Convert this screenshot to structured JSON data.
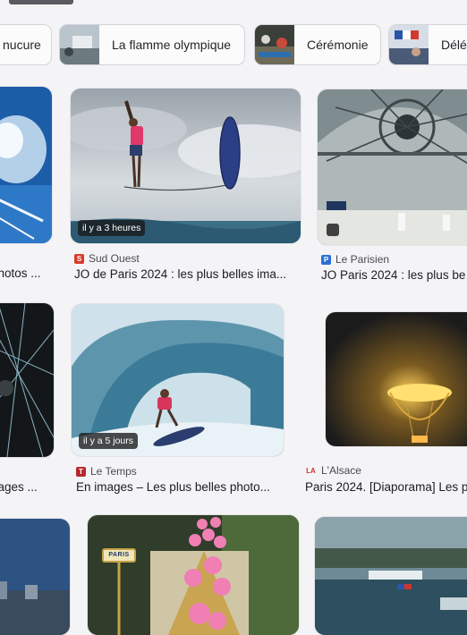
{
  "chips": [
    {
      "label": "nucure"
    },
    {
      "label": "La flamme olympique"
    },
    {
      "label": "Cérémonie"
    },
    {
      "label": "Délég"
    }
  ],
  "cards": {
    "surf1": {
      "time": "il y a 3 heures",
      "source": "Sud Ouest",
      "title": "JO de Paris 2024 : les plus belles ima..."
    },
    "dome": {
      "source": "Le Parisien",
      "title": "JO Paris 2024 : les plus be"
    },
    "left_top": {
      "title": "photos ..."
    },
    "surf2": {
      "time": "il y a 5 jours",
      "source": "Le Temps",
      "title": "En images – Les plus belles photo..."
    },
    "balloon": {
      "source": "L'Alsace",
      "title": "Paris 2024. [Diaporama] Les p"
    },
    "left_mid": {
      "title": "nages ..."
    },
    "paris_sign": {
      "sign": "PARIS"
    }
  },
  "colors": {
    "sud_ouest": "#d93a2b",
    "le_parisien": "#2a6fd6",
    "le_temps": "#b5282e",
    "l_alsace": "#d2342c"
  }
}
